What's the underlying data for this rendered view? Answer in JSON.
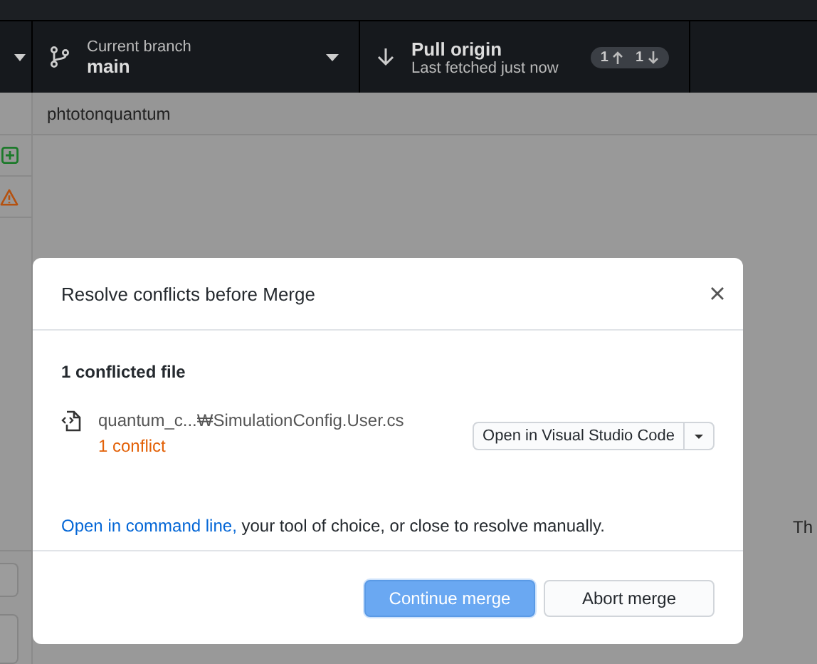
{
  "toolbar": {
    "branch": {
      "label": "Current branch",
      "value": "main"
    },
    "pull": {
      "label": "Pull origin",
      "subtitle": "Last fetched just now",
      "ahead": "1",
      "behind": "1"
    }
  },
  "repo_tab": "phtotonquantum",
  "sidebar": {
    "items": [
      {
        "kind": "added"
      },
      {
        "kind": "conflict"
      }
    ]
  },
  "background_text": "Th",
  "dialog": {
    "title": "Resolve conflicts before Merge",
    "heading": "1 conflicted file",
    "files": [
      {
        "path": "quantum_c...₩SimulationConfig.User.cs",
        "status": "1 conflict"
      }
    ],
    "open_button": "Open in Visual Studio Code",
    "note_link": "Open in command line,",
    "note_text": "your tool of choice, or close to resolve manually.",
    "buttons": [
      {
        "label": "Continue merge",
        "primary": true
      },
      {
        "label": "Abort merge",
        "primary": false
      }
    ]
  }
}
